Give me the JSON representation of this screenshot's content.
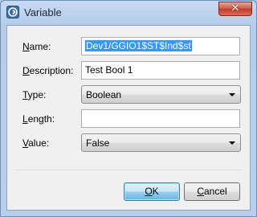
{
  "window": {
    "title": "Variable",
    "close_symbol": "✕"
  },
  "form": {
    "name": {
      "label": "Name:",
      "mnemonic": "N",
      "label_rest": "ame:",
      "value_selected": "Dev1/GGIO1$ST$Ind$st"
    },
    "description": {
      "label": "Description:",
      "mnemonic": "D",
      "label_rest": "escription:",
      "value": "Test Bool 1"
    },
    "type": {
      "label": "Type:",
      "mnemonic": "T",
      "label_rest": "ype:",
      "value": "Boolean"
    },
    "length": {
      "label": "Length:",
      "mnemonic": "L",
      "label_rest": "ength:",
      "value": ""
    },
    "val": {
      "label": "Value:",
      "mnemonic": "V",
      "label_rest": "alue:",
      "value": "False"
    }
  },
  "buttons": {
    "ok": {
      "mnemonic": "O",
      "rest": "K"
    },
    "cancel": {
      "mnemonic": "C",
      "rest": "ancel"
    }
  },
  "icons": {
    "app": "app-logo-icon",
    "close": "close-icon",
    "dropdown": "chevron-down-icon"
  }
}
